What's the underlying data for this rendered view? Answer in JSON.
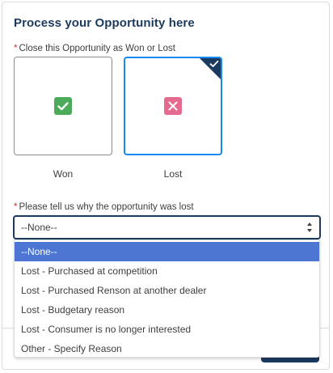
{
  "title": "Process your Opportunity here",
  "close_field": {
    "required_mark": "*",
    "label": "Close this Opportunity as Won or Lost",
    "options": [
      {
        "label": "Won",
        "icon": "check-icon",
        "color": "#4bab5b",
        "selected": false
      },
      {
        "label": "Lost",
        "icon": "close-icon",
        "color": "#e56a8f",
        "selected": true
      }
    ]
  },
  "reason_field": {
    "required_mark": "*",
    "label": "Please tell us why the opportunity was lost",
    "selected_value": "--None--",
    "options": [
      "--None--",
      "Lost - Purchased at competition",
      "Lost - Purchased Renson at another dealer",
      "Lost - Budgetary reason",
      "Lost - Consumer is no longer interested",
      "Other - Specify Reason"
    ],
    "highlighted_index": 0
  },
  "colors": {
    "accent": "#1b3a5f",
    "selection_border": "#1589ee",
    "highlight": "#4d76d2",
    "required": "#c23934"
  }
}
